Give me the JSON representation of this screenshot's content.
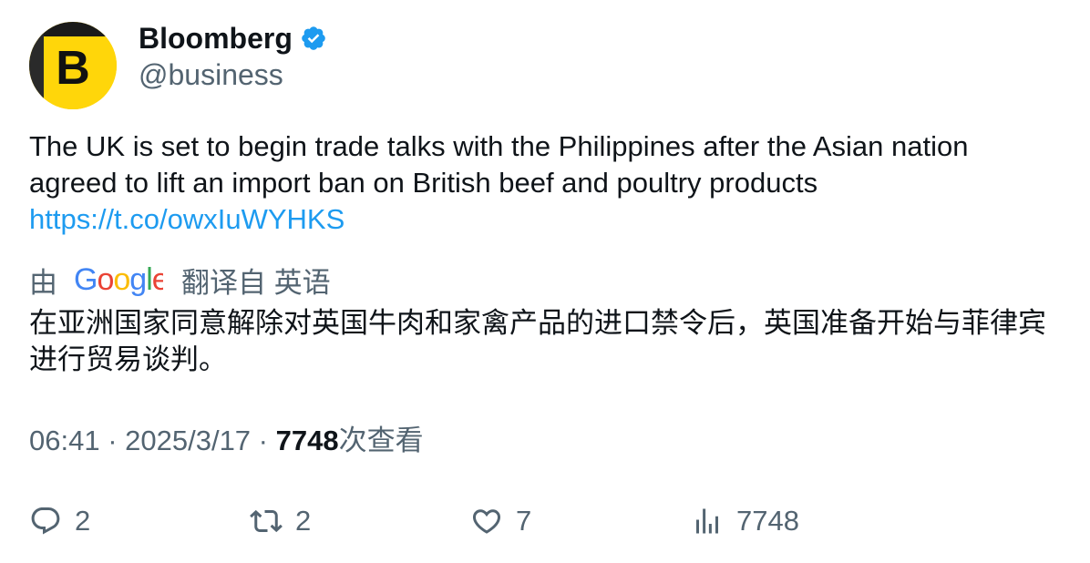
{
  "author": {
    "name": "Bloomberg",
    "handle": "@business",
    "avatar_letter": "B"
  },
  "tweet": {
    "text": "The UK is set to begin trade talks with the Philippines after the Asian nation agreed to lift an import ban on British beef and poultry products",
    "link": "https://t.co/owxIuWYHKS"
  },
  "translation": {
    "prefix": "由",
    "provider": "Google",
    "suffix": "翻译自 英语",
    "text": "在亚洲国家同意解除对英国牛肉和家禽产品的进口禁令后，英国准备开始与菲律宾进行贸易谈判。"
  },
  "meta": {
    "time": "06:41",
    "separator": " · ",
    "date": "2025/3/17",
    "views_count": "7748",
    "views_label": "次查看"
  },
  "actions": {
    "replies": "2",
    "retweets": "2",
    "likes": "7",
    "views": "7748"
  },
  "colors": {
    "link": "#1d9bf0",
    "secondary_text": "#536471",
    "verified_badge": "#1d9bf0",
    "avatar_bg": "#ffd60a"
  }
}
